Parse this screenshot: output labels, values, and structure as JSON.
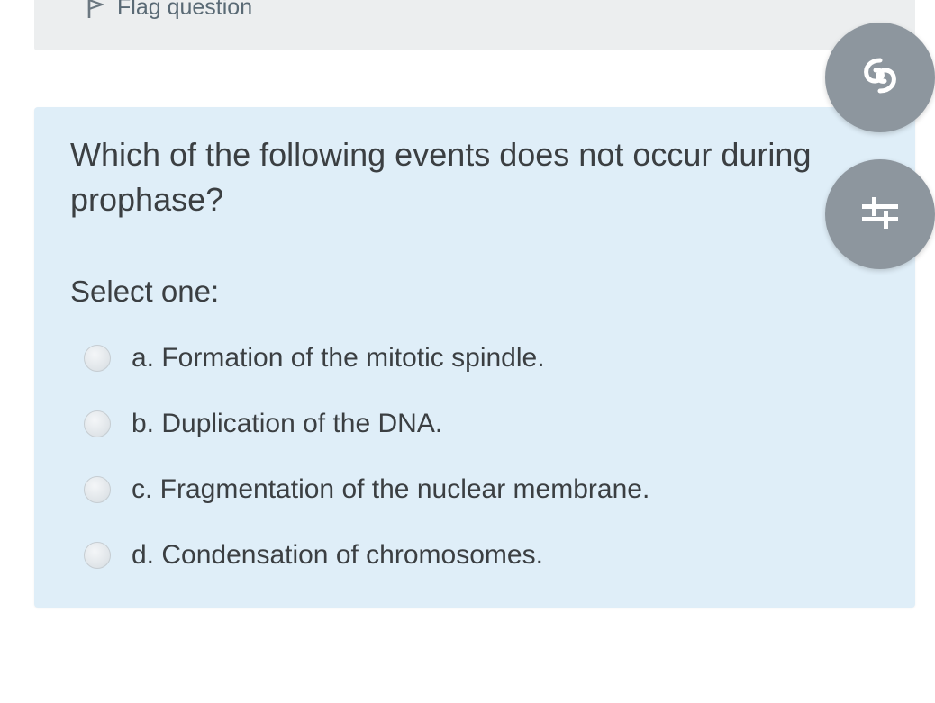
{
  "flag": {
    "label": "Flag question",
    "icon": "flag-icon"
  },
  "question": {
    "text": "Which of the following events does not occur during prophase?",
    "prompt": "Select one:",
    "answers": [
      {
        "label": "a. Formation of the mitotic spindle.",
        "selected": false
      },
      {
        "label": "b. Duplication of the DNA.",
        "selected": false
      },
      {
        "label": "c. Fragmentation of the nuclear membrane.",
        "selected": false
      },
      {
        "label": "d. Condensation of chromosomes.",
        "selected": false
      }
    ]
  },
  "floating_buttons": [
    {
      "icon": "swirl-icon"
    },
    {
      "icon": "sliders-icon"
    }
  ],
  "colors": {
    "card_background": "#dfeef8",
    "flag_bar_background": "#eceeef",
    "fab_background": "#8d969e",
    "text": "#3b3f42"
  }
}
